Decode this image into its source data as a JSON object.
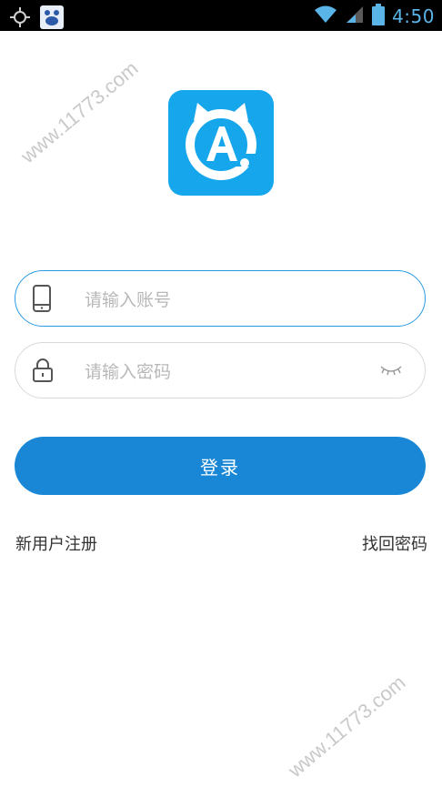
{
  "status_bar": {
    "time": "4:50",
    "icons": [
      "gps-icon",
      "baidu-app-icon",
      "wifi-icon",
      "signal-icon",
      "battery-icon"
    ]
  },
  "watermark": {
    "text": "www.11773.com"
  },
  "login_form": {
    "account_placeholder": "请输入账号",
    "password_placeholder": "请输入密码",
    "login_label": "登录"
  },
  "links": {
    "register": "新用户注册",
    "forgot_password": "找回密码"
  },
  "colors": {
    "accent": "#1a87d6",
    "app_icon_bg": "#16a6eb",
    "status_bar": "#000000",
    "status_icon": "#5ab4e8"
  }
}
